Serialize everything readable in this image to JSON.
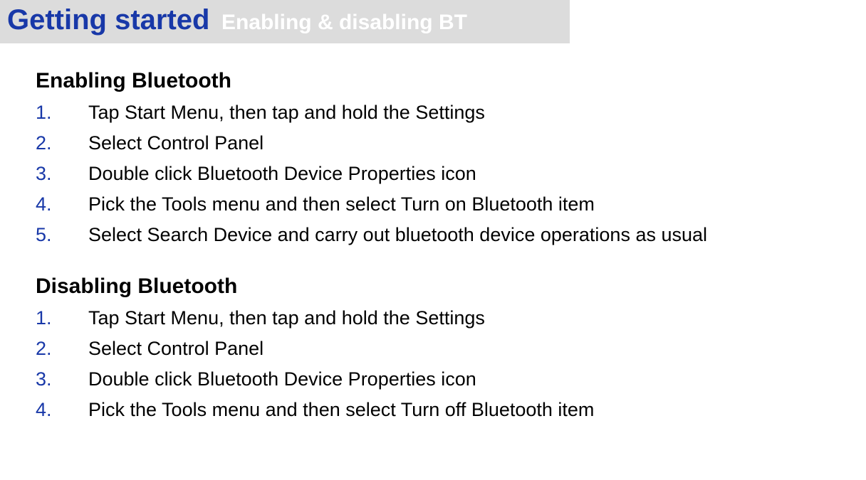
{
  "header": {
    "title": "Getting started",
    "subtitle": "Enabling & disabling BT"
  },
  "sections": {
    "enable": {
      "heading": "Enabling Bluetooth",
      "steps": [
        {
          "num": "1.",
          "text": "Tap Start Menu, then tap and hold the Settings"
        },
        {
          "num": "2.",
          "text": "Select Control Panel"
        },
        {
          "num": "3.",
          "text": "Double click Bluetooth Device Properties icon"
        },
        {
          "num": "4.",
          "text": "Pick the Tools menu and then select Turn on Bluetooth item"
        },
        {
          "num": "5.",
          "text": "Select Search Device and carry out bluetooth device operations as usual"
        }
      ]
    },
    "disable": {
      "heading": "Disabling Bluetooth",
      "steps": [
        {
          "num": "1.",
          "text": "Tap Start Menu, then tap and hold the Settings"
        },
        {
          "num": "2.",
          "text": "Select Control Panel"
        },
        {
          "num": "3.",
          "text": "Double click Bluetooth Device Properties icon"
        },
        {
          "num": "4.",
          "text": "Pick the Tools menu and then select Turn off Bluetooth item"
        }
      ]
    }
  }
}
